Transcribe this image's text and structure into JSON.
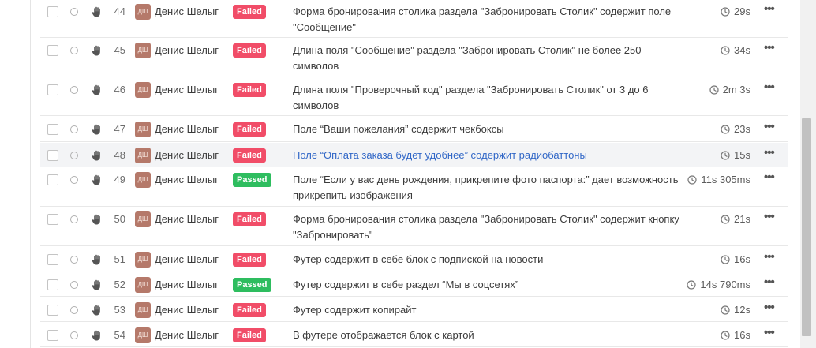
{
  "rows": [
    {
      "num": "44",
      "user": "Денис Шелыг",
      "avatar": "ДШ",
      "status": "Failed",
      "title": "Форма бронирования столика раздела \"Забронировать Столик\" содержит поле \"Сообщение\"",
      "duration": "29s"
    },
    {
      "num": "45",
      "user": "Денис Шелыг",
      "avatar": "ДШ",
      "status": "Failed",
      "title": "Длина поля \"Сообщение\" раздела \"Забронировать Столик\" не более 250 символов",
      "duration": "34s"
    },
    {
      "num": "46",
      "user": "Денис Шелыг",
      "avatar": "ДШ",
      "status": "Failed",
      "title": "Длина поля \"Проверочный код\" раздела \"Забронировать Столик\" от 3 до 6 символов",
      "duration": "2m 3s"
    },
    {
      "num": "47",
      "user": "Денис Шелыг",
      "avatar": "ДШ",
      "status": "Failed",
      "title": "Поле “Ваши пожелания” содержит чекбоксы",
      "duration": "23s"
    },
    {
      "num": "48",
      "user": "Денис Шелыг",
      "avatar": "ДШ",
      "status": "Failed",
      "title": "Поле “Оплата заказа будет удобнее” содержит радиобаттоны",
      "duration": "15s"
    },
    {
      "num": "49",
      "user": "Денис Шелыг",
      "avatar": "ДШ",
      "status": "Passed",
      "title": "Поле “Если у вас день рождения, прикрепите фото паспорта:” дает возможность прикрепить изображения",
      "duration": "11s 305ms"
    },
    {
      "num": "50",
      "user": "Денис Шелыг",
      "avatar": "ДШ",
      "status": "Failed",
      "title": "Форма бронирования столика раздела \"Забронировать Столик\" содержит кнопку \"Забронировать\"",
      "duration": "21s"
    },
    {
      "num": "51",
      "user": "Денис Шелыг",
      "avatar": "ДШ",
      "status": "Failed",
      "title": "Футер содержит в себе блок с подпиской на новости",
      "duration": "16s"
    },
    {
      "num": "52",
      "user": "Денис Шелыг",
      "avatar": "ДШ",
      "status": "Passed",
      "title": "Футер содержит в себе раздел “Мы в соцсетях”",
      "duration": "14s 790ms"
    },
    {
      "num": "53",
      "user": "Денис Шелыг",
      "avatar": "ДШ",
      "status": "Failed",
      "title": "Футер содержит копирайт",
      "duration": "12s"
    },
    {
      "num": "54",
      "user": "Денис Шелыг",
      "avatar": "ДШ",
      "status": "Failed",
      "title": "В футере отображается блок с картой",
      "duration": "16s"
    }
  ],
  "colors": {
    "failed": "#f14d68",
    "passed": "#2ebd5f",
    "link": "#3167c7",
    "avatar": "#b5796a"
  },
  "icons": {
    "status": "circle-icon",
    "manual": "hand-icon",
    "duration": "clock-icon",
    "actions": "more-icon"
  }
}
